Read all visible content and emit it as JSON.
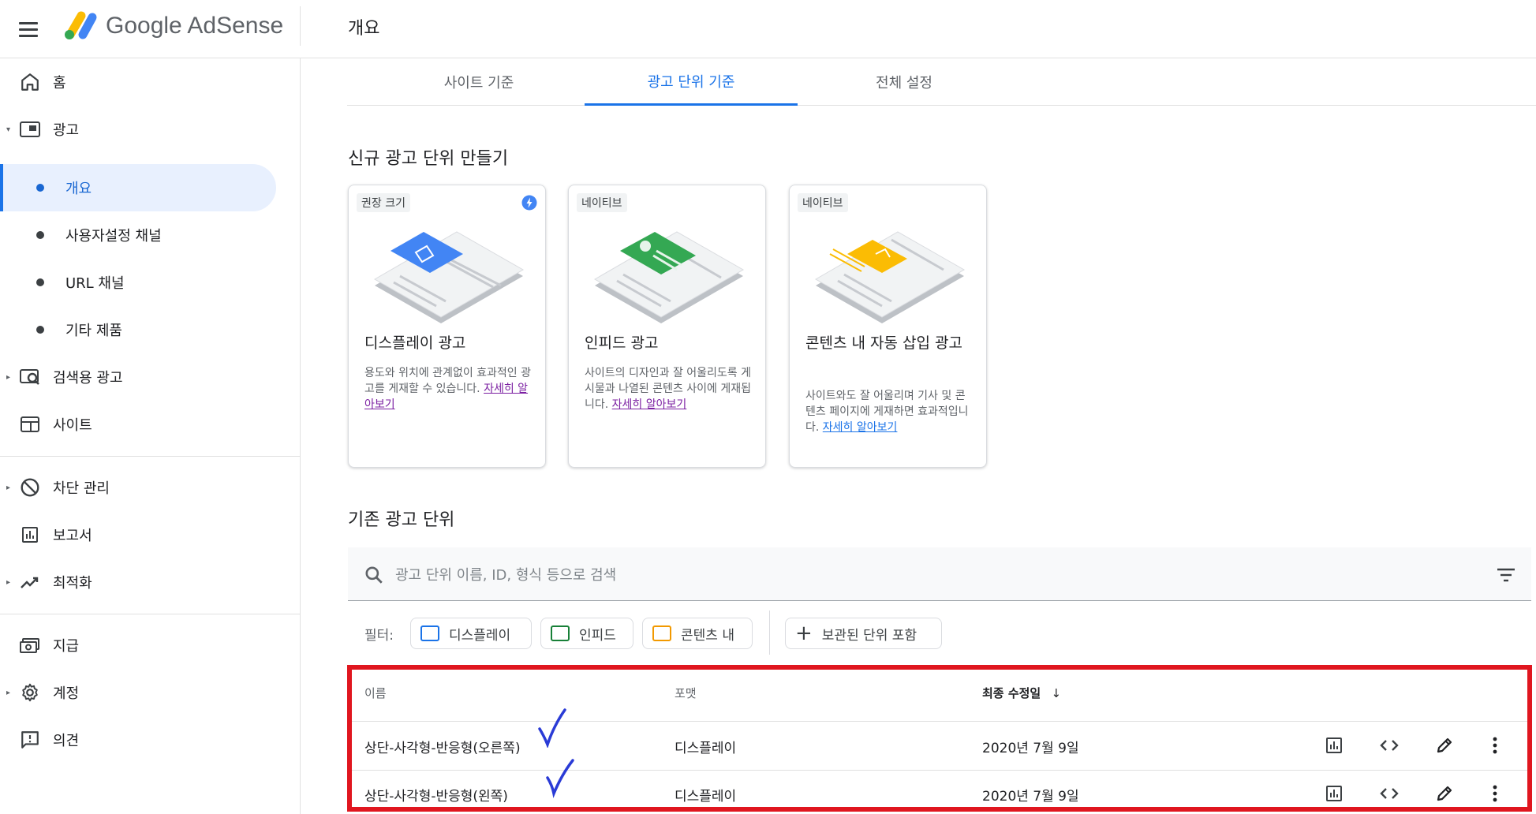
{
  "header": {
    "brand": "Google AdSense",
    "page_title": "개요"
  },
  "sidebar": {
    "items": [
      {
        "label": "홈",
        "icon": "home-icon"
      },
      {
        "label": "광고",
        "icon": "ads-icon"
      },
      {
        "label": "개요"
      },
      {
        "label": "사용자설정 채널"
      },
      {
        "label": "URL 채널"
      },
      {
        "label": "기타 제품"
      },
      {
        "label": "검색용 광고",
        "icon": "search-ads-icon"
      },
      {
        "label": "사이트",
        "icon": "sites-icon"
      },
      {
        "label": "차단 관리",
        "icon": "block-icon"
      },
      {
        "label": "보고서",
        "icon": "reports-icon"
      },
      {
        "label": "최적화",
        "icon": "trending-icon"
      },
      {
        "label": "지급",
        "icon": "payments-icon"
      },
      {
        "label": "계정",
        "icon": "settings-icon"
      },
      {
        "label": "의견",
        "icon": "feedback-icon"
      }
    ]
  },
  "tabs": [
    {
      "label": "사이트 기준"
    },
    {
      "label": "광고 단위 기준"
    },
    {
      "label": "전체 설정"
    }
  ],
  "create_section": {
    "title": "신규 광고 단위 만들기",
    "cards": [
      {
        "chip": "권장 크기",
        "title": "디스플레이 광고",
        "desc": "용도와 위치에 관계없이 효과적인 광고를 게재할 수 있습니다.",
        "link": "자세히 알아보기"
      },
      {
        "chip": "네이티브",
        "title": "인피드 광고",
        "desc": "사이트의 디자인과 잘 어울리도록 게시물과 나열된 콘텐츠 사이에 게재됩니다.",
        "link": "자세히 알아보기"
      },
      {
        "chip": "네이티브",
        "title": "콘텐츠 내 자동 삽입 광고",
        "desc": "사이트와도 잘 어울리며 기사 및 콘텐츠 페이지에 게재하면 효과적입니다.",
        "link": "자세히 알아보기"
      }
    ]
  },
  "existing_section": {
    "title": "기존 광고 단위",
    "search_placeholder": "광고 단위 이름, ID, 형식 등으로 검색",
    "filter_label": "필터:",
    "filters": [
      {
        "label": "디스플레이",
        "color": "#1a73e8"
      },
      {
        "label": "인피드",
        "color": "#188038"
      },
      {
        "label": "콘텐츠 내",
        "color": "#f29900"
      },
      {
        "label": "보관된 단위 포함"
      }
    ],
    "columns": [
      "이름",
      "포맷",
      "최종 수정일"
    ],
    "rows": [
      {
        "name": "상단-사각형-반응형(오른쪽)",
        "format": "디스플레이",
        "date": "2020년 7월 9일"
      },
      {
        "name": "상단-사각형-반응형(왼쪽)",
        "format": "디스플레이",
        "date": "2020년 7월 9일"
      }
    ]
  },
  "colors": {
    "accent": "#1a73e8",
    "highlight_box": "#e0161f",
    "checkmark": "#2a3bd6"
  }
}
